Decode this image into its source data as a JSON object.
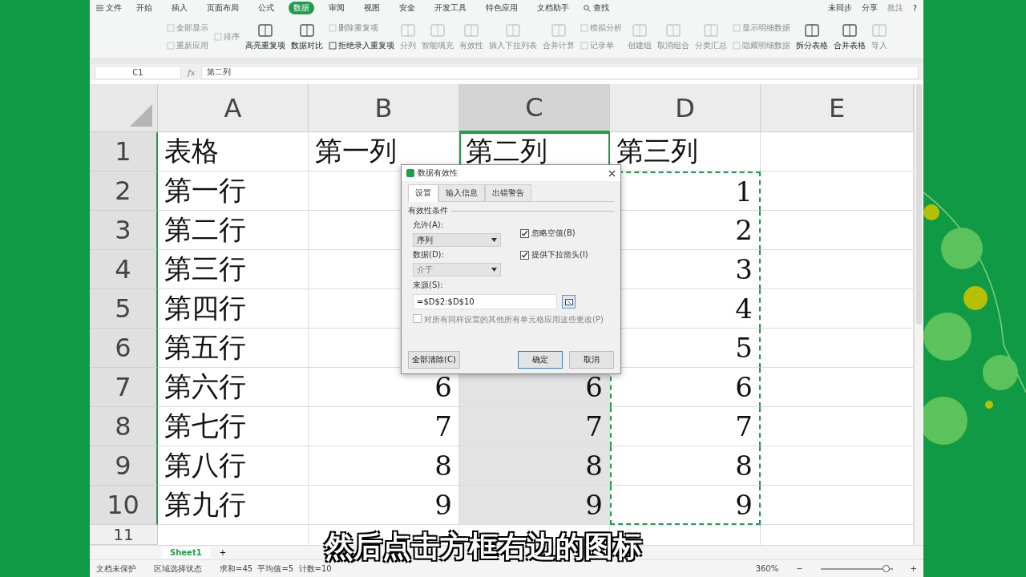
{
  "menu": {
    "file": "文件",
    "tabs": [
      {
        "label": "开始",
        "selected": false
      },
      {
        "label": "插入",
        "selected": false
      },
      {
        "label": "页面布局",
        "selected": false
      },
      {
        "label": "公式",
        "selected": false
      },
      {
        "label": "数据",
        "selected": true
      },
      {
        "label": "审阅",
        "selected": false
      },
      {
        "label": "视图",
        "selected": false
      },
      {
        "label": "安全",
        "selected": false
      },
      {
        "label": "开发工具",
        "selected": false
      },
      {
        "label": "特色应用",
        "selected": false
      },
      {
        "label": "文档助手",
        "selected": false
      }
    ],
    "search": "查找",
    "sync": "未同步",
    "share": "分享",
    "comment": "批注",
    "help": "?"
  },
  "ribbon": [
    {
      "kind": "stack",
      "items": [
        {
          "label": "全部显示",
          "disabled": true
        },
        {
          "label": "重新应用",
          "disabled": true
        }
      ]
    },
    {
      "kind": "stack",
      "items": [
        {
          "label": "排序",
          "disabled": true
        }
      ]
    },
    {
      "kind": "large",
      "label": "高亮重复项",
      "disabled": false
    },
    {
      "kind": "large",
      "label": "数据对比",
      "disabled": false
    },
    {
      "kind": "stack",
      "items": [
        {
          "label": "删除重复项",
          "disabled": true
        },
        {
          "label": "拒绝录入重复项",
          "disabled": false
        }
      ]
    },
    {
      "kind": "large",
      "label": "分列",
      "disabled": true
    },
    {
      "kind": "large",
      "label": "智能填充",
      "disabled": true
    },
    {
      "kind": "large",
      "label": "有效性",
      "disabled": true
    },
    {
      "kind": "large",
      "label": "插入下拉列表",
      "disabled": true
    },
    {
      "kind": "large",
      "label": "合并计算",
      "disabled": true
    },
    {
      "kind": "stack",
      "items": [
        {
          "label": "模拟分析",
          "disabled": true
        },
        {
          "label": "记录单",
          "disabled": true
        }
      ]
    },
    {
      "kind": "large",
      "label": "创建组",
      "disabled": true
    },
    {
      "kind": "large",
      "label": "取消组合",
      "disabled": true
    },
    {
      "kind": "large",
      "label": "分类汇总",
      "disabled": true
    },
    {
      "kind": "stack",
      "items": [
        {
          "label": "显示明细数据",
          "disabled": true
        },
        {
          "label": "隐藏明细数据",
          "disabled": true
        }
      ]
    },
    {
      "kind": "large",
      "label": "拆分表格",
      "disabled": false
    },
    {
      "kind": "large",
      "label": "合并表格",
      "disabled": false
    },
    {
      "kind": "large",
      "label": "导入",
      "disabled": true
    }
  ],
  "formula_bar": {
    "cell": "C1",
    "fx": "fx",
    "value": "第二列"
  },
  "columns": [
    {
      "label": "A",
      "selected": false
    },
    {
      "label": "B",
      "selected": false
    },
    {
      "label": "C",
      "selected": true
    },
    {
      "label": "D",
      "selected": false
    },
    {
      "label": "E",
      "selected": false
    }
  ],
  "rows": [
    {
      "label": "1",
      "selected": true,
      "cells": [
        "表格",
        "第一列",
        "第二列",
        "第三列",
        null
      ]
    },
    {
      "label": "2",
      "selected": true,
      "cells": [
        "第一行",
        null,
        null,
        "1",
        null
      ]
    },
    {
      "label": "3",
      "selected": true,
      "cells": [
        "第二行",
        null,
        null,
        "2",
        null
      ]
    },
    {
      "label": "4",
      "selected": true,
      "cells": [
        "第三行",
        null,
        null,
        "3",
        null
      ]
    },
    {
      "label": "5",
      "selected": true,
      "cells": [
        "第四行",
        null,
        null,
        "4",
        null
      ]
    },
    {
      "label": "6",
      "selected": true,
      "cells": [
        "第五行",
        null,
        null,
        "5",
        null
      ]
    },
    {
      "label": "7",
      "selected": true,
      "cells": [
        "第六行",
        "6",
        "6",
        "6",
        null
      ]
    },
    {
      "label": "8",
      "selected": true,
      "cells": [
        "第七行",
        "7",
        "7",
        "7",
        null
      ]
    },
    {
      "label": "9",
      "selected": true,
      "cells": [
        "第八行",
        "8",
        "8",
        "8",
        null
      ]
    },
    {
      "label": "10",
      "selected": true,
      "cells": [
        "第九行",
        "9",
        "9",
        "9",
        null
      ]
    },
    {
      "label": "11",
      "selected": false,
      "cells": [
        null,
        null,
        null,
        null,
        null
      ]
    }
  ],
  "dialog": {
    "title": "数据有效性",
    "tabs": [
      {
        "label": "设置",
        "selected": true
      },
      {
        "label": "输入信息",
        "selected": false
      },
      {
        "label": "出错警告",
        "selected": false
      }
    ],
    "section": "有效性条件",
    "allow_label": "允许(A):",
    "allow_value": "序列",
    "data_label": "数据(D):",
    "data_value": "介于",
    "data_disabled": true,
    "checks": [
      {
        "label": "忽略空值(B)",
        "checked": true
      },
      {
        "label": "提供下拉箭头(I)",
        "checked": true
      }
    ],
    "source_label": "来源(S):",
    "source_value": "=$D$2:$D$10",
    "apply_all": {
      "label": "对所有同样设置的其他所有单元格应用这些更改(P)",
      "checked": false,
      "disabled": true
    },
    "clear": "全部清除(C)",
    "ok": "确定",
    "cancel": "取消"
  },
  "sheet_tabs": [
    {
      "label": "Sheet1",
      "selected": true
    }
  ],
  "add_sheet": "+",
  "status": {
    "protect": "文档未保护",
    "mode": "区域选择状态",
    "stats": "求和=45  平均值=5  计数=10",
    "zoom": "360%",
    "zoom_slider": {
      "level": 0.9
    },
    "minus": "−",
    "plus": "+"
  },
  "subtitle": "然后点击方框右边的图标"
}
